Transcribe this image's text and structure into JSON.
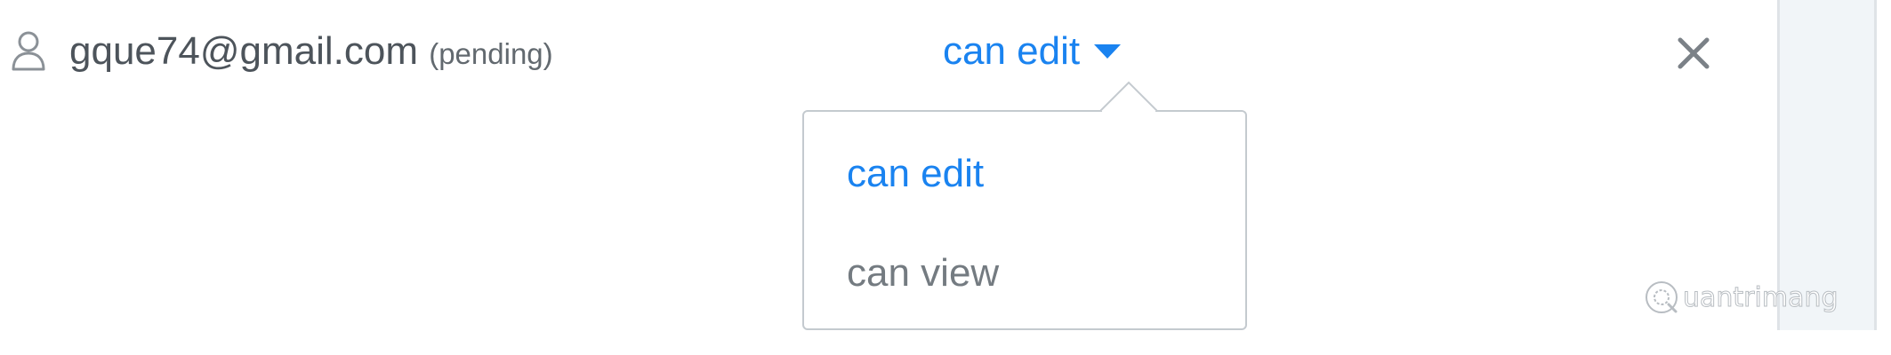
{
  "share": {
    "email": "gque74@gmail.com",
    "status": "(pending)",
    "role": "can edit",
    "role_options": [
      {
        "label": "can edit",
        "selected": true
      },
      {
        "label": "can view",
        "selected": false
      }
    ]
  },
  "icons": {
    "user": "user-icon",
    "caret": "caret-down-icon",
    "remove": "close-icon",
    "watermark_logo": "watermark-logo-icon"
  },
  "watermark": {
    "text": "uantrimang"
  },
  "colors": {
    "accent": "#1a83f0",
    "text": "#4d545b",
    "muted": "#747b81",
    "border": "#c4cacf",
    "panel": "#f1f5f8"
  }
}
